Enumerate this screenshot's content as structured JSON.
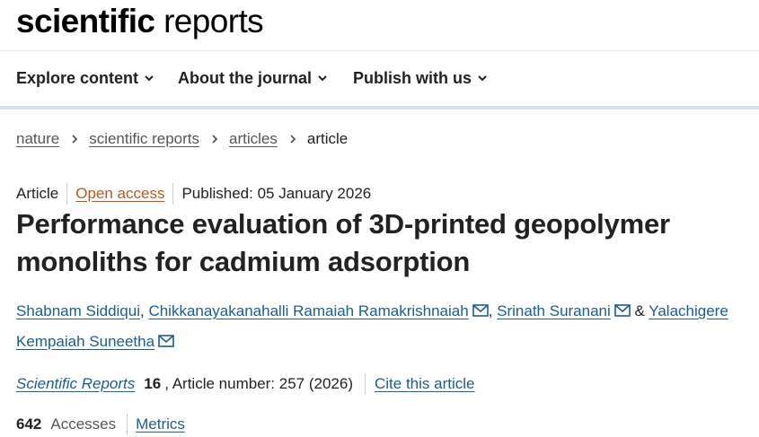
{
  "site": {
    "logo_bold": "scientific",
    "logo_light": " reports"
  },
  "nav": {
    "items": [
      {
        "label": "Explore content"
      },
      {
        "label": "About the journal"
      },
      {
        "label": "Publish with us"
      }
    ]
  },
  "breadcrumb": {
    "items": [
      "nature",
      "scientific reports",
      "articles"
    ],
    "current": "article"
  },
  "article": {
    "type": "Article",
    "access": "Open access",
    "published": "Published: 05 January 2026",
    "title": "Performance evaluation of 3D-printed geopolymer monoliths for cadmium adsorption",
    "authors": [
      "Shabnam Siddiqui",
      "Chikkanayakanahalli Ramaiah Ramakrishnaiah",
      "Srinath Suranani",
      "Yalachigere Kempaiah Suneetha"
    ],
    "separators": {
      "comma": ", ",
      "amp": " & "
    },
    "journal": "Scientific Reports",
    "volume": "16",
    "article_number": ", Article number: 257 (2026)",
    "cite_label": "Cite this article",
    "accesses_count": "642",
    "accesses_label": "Accesses",
    "metrics_label": "Metrics"
  },
  "colors": {
    "link": "#1a5d8f",
    "open_access": "#b55a1f",
    "nav_rule": "#d5e0e6"
  },
  "icons": [
    "chevron-down-icon",
    "chevron-right-icon",
    "envelope-icon"
  ]
}
